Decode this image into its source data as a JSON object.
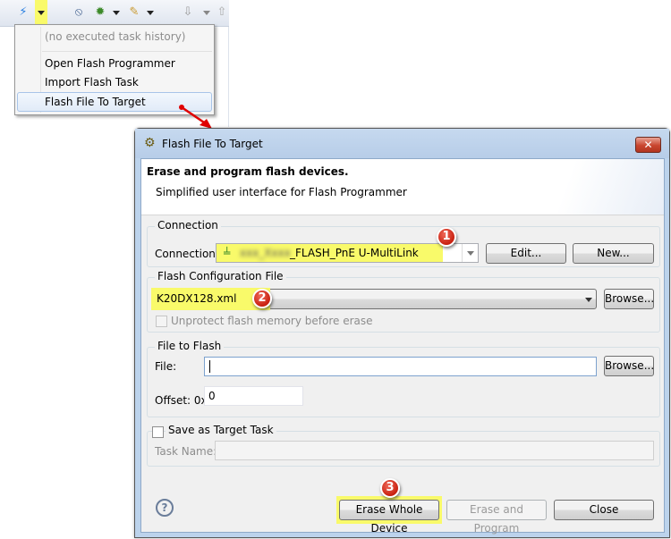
{
  "toolbar": {
    "icons": [
      "flash-programmer-icon",
      "dropdown-arrow",
      "debug-off-icon",
      "bug-icon",
      "launch-pen-icon",
      "import-icon",
      "export-icon"
    ]
  },
  "menu": {
    "history_placeholder": "(no executed task history)",
    "items": [
      {
        "label": "Open Flash Programmer"
      },
      {
        "label": "Import Flash Task"
      },
      {
        "label": "Flash File To Target",
        "highlighted": true
      }
    ]
  },
  "dialog": {
    "title": "Flash File To Target",
    "close_symbol": "✕",
    "header_title": "Erase and program flash devices.",
    "header_subtitle": "Simplified user interface for Flash Programmer",
    "connection": {
      "group_label": "Connection",
      "label": "Connection:",
      "value_blurred": "xxx_Xxxx",
      "value": "_FLASH_PnE U-MultiLink",
      "edit_label": "Edit...",
      "new_label": "New..."
    },
    "flash_config": {
      "group_label": "Flash Configuration File",
      "value": "K20DX128.xml",
      "browse_label": "Browse...",
      "unprotect_label": "Unprotect flash memory before erase",
      "unprotect_checked": false
    },
    "file_to_flash": {
      "group_label": "File to Flash",
      "file_label": "File:",
      "file_value": "",
      "browse_label": "Browse...",
      "offset_label": "Offset: 0x",
      "offset_value": "0"
    },
    "target_task": {
      "checkbox_label": "Save as Target Task",
      "checked": false,
      "task_name_label": "Task Name:",
      "task_name_value": ""
    },
    "buttons": {
      "help_symbol": "?",
      "erase_whole": "Erase Whole Device",
      "erase_program": "Erase and Program",
      "close": "Close"
    }
  },
  "annotations": {
    "badge1": "1",
    "badge2": "2",
    "badge3": "3",
    "highlight_color": "#f9fa6a",
    "badge_color": "#d2281a",
    "arrow_color": "#e00000"
  }
}
